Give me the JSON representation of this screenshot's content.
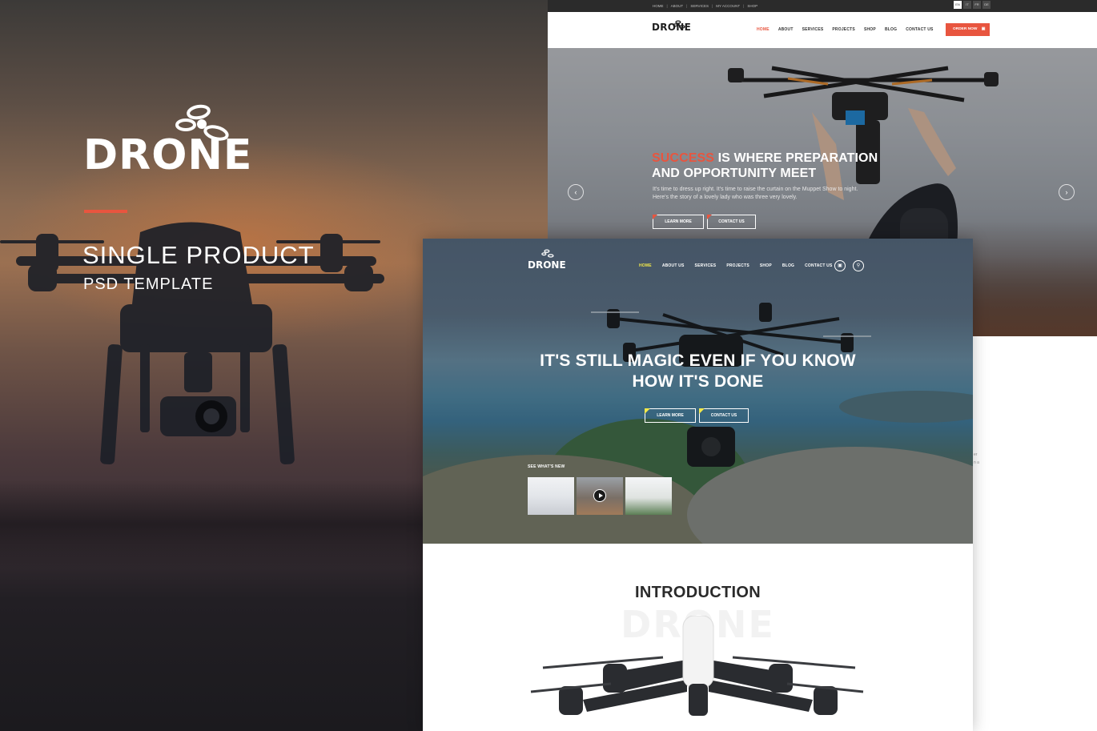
{
  "colors": {
    "accent": "#e8553f",
    "highlight": "#f3e84a",
    "topbar": "#2b2b2b"
  },
  "promo": {
    "logo": "DRONE",
    "logo_icon": "drone-logo-icon",
    "title": "SINGLE PRODUCT",
    "subtitle": "PSD TEMPLATE"
  },
  "screen1": {
    "topbar_links": [
      "HOME",
      "ABOUT",
      "SERVICES",
      "MY ACCOUNT",
      "SHOP"
    ],
    "languages": [
      "EN",
      "IT",
      "FR",
      "DE"
    ],
    "active_language": "EN",
    "logo": "DRONE",
    "menu": [
      "HOME",
      "ABOUT",
      "SERVICES",
      "PROJECTS",
      "SHOP",
      "BLOG",
      "CONTACT US"
    ],
    "active_menu": "HOME",
    "order_button": "ORDER NOW",
    "cart_icon": "cart-icon",
    "hero": {
      "title_accent": "SUCCESS",
      "title_line1_rest": " IS WHERE PREPARATION",
      "title_line2": "AND OPPORTUNITY MEET",
      "text": "It's time to dress up right. It's time to raise the curtain on the Muppet Show to night. Here's the story of a lovely lady who was three very lovely.",
      "learn_more": "LEARN MORE",
      "contact_us": "CONTACT US",
      "prev_arrow": "‹",
      "next_arrow": "›"
    }
  },
  "screen2": {
    "logo": "DRONE",
    "menu": [
      "HOME",
      "ABOUT US",
      "SERVICES",
      "PROJECTS",
      "SHOP",
      "BLOG",
      "CONTACT US"
    ],
    "active_menu": "HOME",
    "hero": {
      "title_line1": "IT'S STILL MAGIC EVEN IF YOU KNOW",
      "title_line2": "HOW IT'S DONE",
      "learn_more": "LEARN MORE",
      "contact_us": "CONTACT US"
    },
    "whats_new": "SEE WHAT'S NEW",
    "intro": {
      "title": "INTRODUCTION",
      "watermark": "DRONE"
    }
  },
  "side_fragments": [
    "er",
    "n a"
  ]
}
